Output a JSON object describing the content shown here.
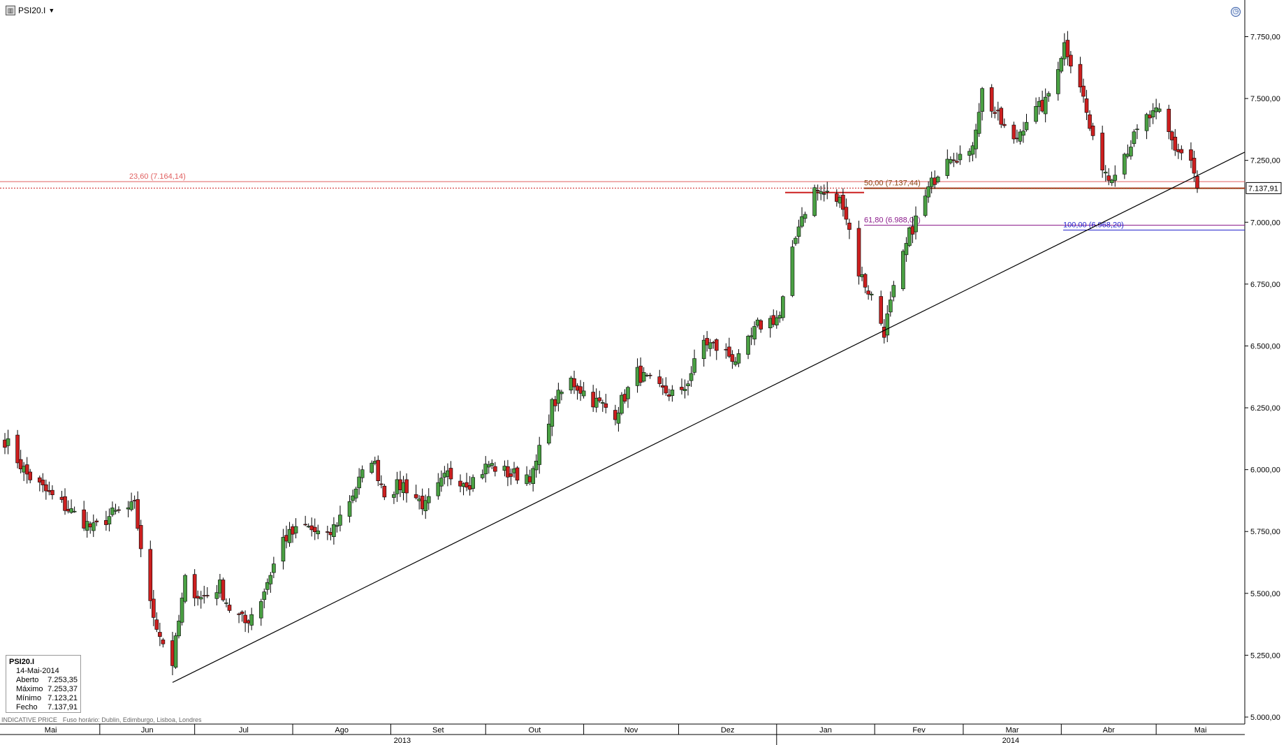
{
  "toolbar": {
    "symbol": "PSI20.I"
  },
  "info": {
    "symbol": "PSI20.I",
    "date": "14-Mai-2014",
    "open_label": "Aberto",
    "open": "7.253,35",
    "high_label": "Máximo",
    "high": "7.253,37",
    "low_label": "Mínimo",
    "low": "7.123,21",
    "close_label": "Fecho",
    "close": "7.137,91"
  },
  "footer": {
    "source": "INDICATIVE PRICE",
    "timezone": "Fuso horário: Dublin, Edimburgo, Lisboa, Londres"
  },
  "price_tag": "7.137,91",
  "colors": {
    "up": "#4aa043",
    "down": "#cc1f1f",
    "trend": "#000000",
    "fib50": "#8b4513",
    "fib618": "#8b1a8b",
    "fib100": "#2222cc",
    "fib236": "#e06060"
  },
  "chart_data": {
    "type": "candlestick",
    "ylim": [
      5000,
      7800
    ],
    "y_ticks": [
      "7.750,00",
      "7.500,00",
      "7.250,00",
      "7.000,00",
      "6.750,00",
      "6.500,00",
      "6.250,00",
      "6.000,00",
      "5.750,00",
      "5.500,00",
      "5.250,00",
      "5.000,00"
    ],
    "y_tick_values": [
      7750,
      7500,
      7250,
      7000,
      6750,
      6500,
      6250,
      6000,
      5750,
      5500,
      5250,
      5000
    ],
    "months": [
      "Mai",
      "Jun",
      "Jul",
      "Ago",
      "Set",
      "Out",
      "Nov",
      "Dez",
      "Jan",
      "Fev",
      "Mar",
      "Abr",
      "Mai"
    ],
    "years": [
      "2013",
      "2014"
    ],
    "fib_levels": [
      {
        "label": "23,60 (7.164,14)",
        "value": 7164.14
      },
      {
        "label": "50,00 (7.137,44)",
        "value": 7137.44
      },
      {
        "label": "61,80 (6.988,08)",
        "value": 6988.08
      },
      {
        "label": "100,00 (6.968,20)",
        "value": 6968.2
      }
    ],
    "last_close": 7137.91,
    "trendline": [
      {
        "x": "2013-06-24",
        "y": 5140
      },
      {
        "x": "2014-05-19",
        "y": 7220
      }
    ],
    "anchors": [
      [
        "2013-05-02",
        6120
      ],
      [
        "2013-05-09",
        5980
      ],
      [
        "2013-05-16",
        5900
      ],
      [
        "2013-05-23",
        5830
      ],
      [
        "2013-05-30",
        5760
      ],
      [
        "2013-06-05",
        5820
      ],
      [
        "2013-06-12",
        5850
      ],
      [
        "2013-06-17",
        5450
      ],
      [
        "2013-06-21",
        5300
      ],
      [
        "2013-06-24",
        5220
      ],
      [
        "2013-06-28",
        5550
      ],
      [
        "2013-07-03",
        5480
      ],
      [
        "2013-07-09",
        5530
      ],
      [
        "2013-07-12",
        5440
      ],
      [
        "2013-07-17",
        5380
      ],
      [
        "2013-07-22",
        5480
      ],
      [
        "2013-07-29",
        5720
      ],
      [
        "2013-08-05",
        5770
      ],
      [
        "2013-08-12",
        5720
      ],
      [
        "2013-08-19",
        5880
      ],
      [
        "2013-08-26",
        6050
      ],
      [
        "2013-08-30",
        5910
      ],
      [
        "2013-09-05",
        5940
      ],
      [
        "2013-09-12",
        5850
      ],
      [
        "2013-09-19",
        5980
      ],
      [
        "2013-09-26",
        5950
      ],
      [
        "2013-10-02",
        6020
      ],
      [
        "2013-10-09",
        5980
      ],
      [
        "2013-10-16",
        5980
      ],
      [
        "2013-10-22",
        6260
      ],
      [
        "2013-10-28",
        6360
      ],
      [
        "2013-11-04",
        6280
      ],
      [
        "2013-11-11",
        6230
      ],
      [
        "2013-11-18",
        6390
      ],
      [
        "2013-11-25",
        6320
      ],
      [
        "2013-12-02",
        6300
      ],
      [
        "2013-12-09",
        6520
      ],
      [
        "2013-12-16",
        6470
      ],
      [
        "2013-12-20",
        6440
      ],
      [
        "2013-12-26",
        6580
      ],
      [
        "2014-01-02",
        6620
      ],
      [
        "2014-01-08",
        7000
      ],
      [
        "2014-01-13",
        7130
      ],
      [
        "2014-01-17",
        7110
      ],
      [
        "2014-01-22",
        7080
      ],
      [
        "2014-01-27",
        6800
      ],
      [
        "2014-01-31",
        6700
      ],
      [
        "2014-02-04",
        6560
      ],
      [
        "2014-02-07",
        6720
      ],
      [
        "2014-02-12",
        6950
      ],
      [
        "2014-02-18",
        7130
      ],
      [
        "2014-02-24",
        7280
      ],
      [
        "2014-03-03",
        7260
      ],
      [
        "2014-03-07",
        7530
      ],
      [
        "2014-03-12",
        7420
      ],
      [
        "2014-03-17",
        7320
      ],
      [
        "2014-03-21",
        7420
      ],
      [
        "2014-03-27",
        7480
      ],
      [
        "2014-04-02",
        7720
      ],
      [
        "2014-04-07",
        7560
      ],
      [
        "2014-04-11",
        7320
      ],
      [
        "2014-04-16",
        7180
      ],
      [
        "2014-04-22",
        7300
      ],
      [
        "2014-04-28",
        7420
      ],
      [
        "2014-05-02",
        7440
      ],
      [
        "2014-05-07",
        7300
      ],
      [
        "2014-05-12",
        7250
      ],
      [
        "2014-05-14",
        7138
      ]
    ]
  }
}
